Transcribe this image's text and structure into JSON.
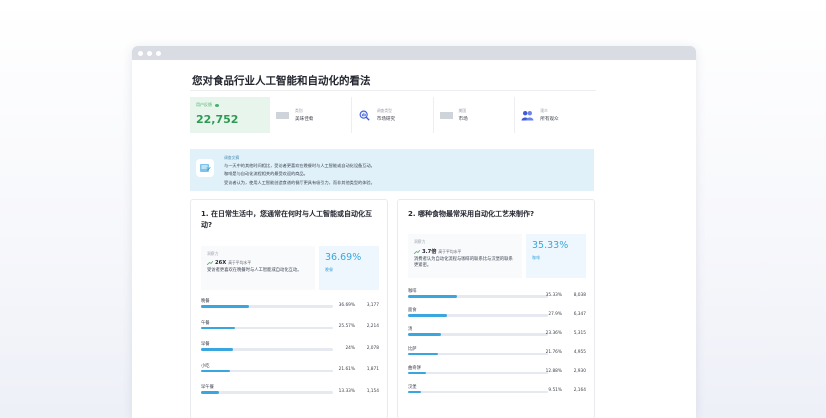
{
  "page": {
    "title": "您对食品行业人工智能和自动化的看法"
  },
  "stats": {
    "respondents": {
      "label": "用户反馈",
      "value": "22,752"
    },
    "items": [
      {
        "icon": "gray-box-icon",
        "label": "类别",
        "value": "美味佳肴"
      },
      {
        "icon": "magnifier-chart-icon",
        "label": "调查类型",
        "value": "市场研究"
      },
      {
        "icon": "gray-box-icon",
        "label": "美国",
        "value": "市场"
      },
      {
        "icon": "people-icon",
        "label": "观众",
        "value": "所有观众"
      }
    ]
  },
  "summary": {
    "title": "调查文摘",
    "lines": [
      "与一天中的其他时间相比，受访者更喜欢在晚餐时与人工智能或自动化设备互动。",
      "咖啡是与自动化流程相关的最受欢迎的商品。",
      "受访者认为，使用人工智能创造食谱的餐厅更具有吸引力，而非其他类型的体验。"
    ]
  },
  "q1": {
    "question": "1. 在日常生活中，您通常在何时与人工智能或自动化互动?",
    "insight": {
      "label": "洞察力",
      "multiplier": "26X",
      "comparison": "高于平均水平",
      "description": "受访者更喜欢在晚餐时与人工智能或自动化互动。"
    },
    "highlight": {
      "pct": "36.69%",
      "label": "晚餐"
    },
    "rows": [
      {
        "name": "晚餐",
        "pct_text": "36.69%",
        "count": "3,177",
        "value": 36.69
      },
      {
        "name": "午餐",
        "pct_text": "25.57%",
        "count": "2,214",
        "value": 25.57
      },
      {
        "name": "早餐",
        "pct_text": "24%",
        "count": "2,078",
        "value": 24
      },
      {
        "name": "小吃",
        "pct_text": "21.61%",
        "count": "1,871",
        "value": 21.61
      },
      {
        "name": "早午餐",
        "pct_text": "13.33%",
        "count": "1,154",
        "value": 13.33
      }
    ]
  },
  "q2": {
    "question": "2. 哪种食物最常采用自动化工艺来制作?",
    "insight": {
      "label": "洞察力",
      "multiplier": "3.7倍",
      "comparison": "高于平均水平",
      "description": "消费者认为自动化流程与咖啡的联系比与汉堡的联系更紧密。"
    },
    "highlight": {
      "pct": "35.33%",
      "label": "咖啡"
    },
    "rows": [
      {
        "name": "咖啡",
        "pct_text": "35.33%",
        "count": "8,038",
        "value": 35.33
      },
      {
        "name": "面食",
        "pct_text": "27.9%",
        "count": "6,347",
        "value": 27.9
      },
      {
        "name": "汤",
        "pct_text": "23.36%",
        "count": "5,315",
        "value": 23.36
      },
      {
        "name": "比萨",
        "pct_text": "21.76%",
        "count": "4,955",
        "value": 21.76
      },
      {
        "name": "曲奇饼",
        "pct_text": "12.88%",
        "count": "2,930",
        "value": 12.88
      },
      {
        "name": "汉堡",
        "pct_text": "9.51%",
        "count": "2,164",
        "value": 9.51
      }
    ]
  },
  "colors": {
    "accent": "#3aa6e0",
    "respondents_green": "#2f9a55",
    "summary_bg": "#e1f1f9"
  }
}
